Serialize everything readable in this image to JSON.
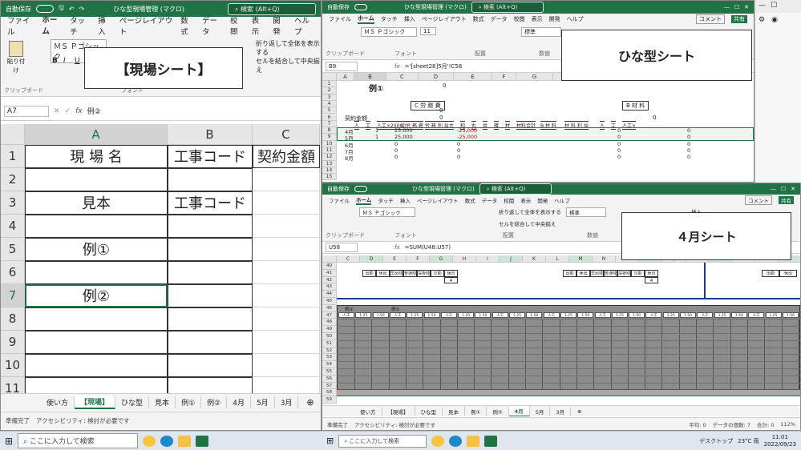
{
  "common": {
    "autosave": "自動保存",
    "autosave_state": "オフ",
    "filename": "ひな型現場管理 (マクロ)",
    "search": "検索 (Alt+Q)",
    "menus": [
      "ファイル",
      "ホーム",
      "タッチ",
      "挿入",
      "ページレイアウト",
      "数式",
      "データ",
      "校閲",
      "表示",
      "開発",
      "ヘルプ"
    ],
    "font": "ＭＳ Ｐゴシック",
    "font_size": "11",
    "wrap_btn": "折り返して全体を表示する",
    "merge_btn": "セルを結合して中央揃え",
    "number_format": "標準",
    "groups": {
      "clipboard": "クリップボード",
      "font": "フォント",
      "align": "配置",
      "number": "数値"
    },
    "paste": "貼り付け",
    "comment_btn": "コメント",
    "share_btn": "共有",
    "tabs": [
      "使い方",
      "【現場】",
      "ひな型",
      "見本",
      "例①",
      "例②",
      "4月",
      "5月",
      "3月"
    ],
    "status_ready": "準備完了",
    "status_access": "アクセシビリティ: 検討が必要です",
    "taskbar_search": "ここに入力して検索",
    "insert_btn": "挿入",
    "desktop": "デスクトップ",
    "weather": "23°C 雨",
    "clock_time": "11:01",
    "clock_date": "2022/09/23",
    "zoom": "112%"
  },
  "left": {
    "callout": "【現場シート】",
    "namebox": "A7",
    "formula": "例②",
    "columns": [
      "A",
      "B",
      "C"
    ],
    "rows": [
      {
        "n": "1",
        "a": "現 場 名",
        "b": "工事コード",
        "c": "契約金額"
      },
      {
        "n": "2",
        "a": "",
        "b": "",
        "c": ""
      },
      {
        "n": "3",
        "a": "見本",
        "b": "工事コード",
        "c": ""
      },
      {
        "n": "4",
        "a": "",
        "b": "",
        "c": ""
      },
      {
        "n": "5",
        "a": "例①",
        "b": "",
        "c": ""
      },
      {
        "n": "6",
        "a": "",
        "b": "",
        "c": ""
      },
      {
        "n": "7",
        "a": "例②",
        "b": "",
        "c": ""
      },
      {
        "n": "8",
        "a": "",
        "b": "",
        "c": ""
      },
      {
        "n": "9",
        "a": "",
        "b": "",
        "c": ""
      },
      {
        "n": "10",
        "a": "",
        "b": "",
        "c": ""
      },
      {
        "n": "11",
        "a": "",
        "b": "",
        "c": ""
      }
    ]
  },
  "top": {
    "callout": "ひな型シート",
    "namebox": "B9",
    "formula": "='[sheet28]5月'!C58",
    "columns": [
      "A",
      "B",
      "C",
      "D",
      "E",
      "F",
      "G",
      "H",
      "I"
    ],
    "title": "例①",
    "title_value": "0",
    "labor_label": "C 労 務 費",
    "contract_label": "契約金額",
    "contract_value": "0",
    "labor_value": "0",
    "material_label": "B 材 料",
    "material_value": "0",
    "headers": [
      "人",
      "工",
      "人工×25000",
      "C 労 務 費",
      "労 務 利 益",
      "大",
      "和",
      "丸",
      "井",
      "雑",
      "材",
      "材料合計",
      "B 材 料",
      "材 料 利 益",
      "",
      "人",
      "工",
      "人工×"
    ],
    "rows": [
      {
        "n": "8",
        "m": "4月",
        "v1": "1",
        "v2": "25,000",
        "v3": "-25,000",
        "v4": "0",
        "v5": "0"
      },
      {
        "n": "9",
        "m": "5月",
        "v1": "1",
        "v2": "25,000",
        "v3": "-25,000",
        "v4": "0",
        "v5": "0"
      },
      {
        "n": "10",
        "m": "6月",
        "v1": "",
        "v2": "0",
        "v3": "0",
        "v4": "0",
        "v5": "0"
      },
      {
        "n": "11",
        "m": "7月",
        "v1": "",
        "v2": "0",
        "v3": "0",
        "v4": "0",
        "v5": "0"
      },
      {
        "n": "12",
        "m": "8月",
        "v1": "",
        "v2": "0",
        "v3": "0",
        "v4": "0",
        "v5": "0"
      }
    ]
  },
  "bottom": {
    "callout": "４月シート",
    "namebox": "U58",
    "formula": "=SUM(U48:U57)",
    "columns": [
      "C",
      "D",
      "E",
      "F",
      "G",
      "H",
      "I",
      "J",
      "K",
      "L",
      "M",
      "N",
      "O",
      "P",
      "Q",
      "R",
      "S",
      "T",
      "U",
      "V"
    ],
    "summary_headers": [
      "出勤",
      "休出",
      "早出残",
      "普通残",
      "深夜残",
      "欠勤",
      "休日"
    ],
    "summary_value": "4",
    "section_labels": [
      "例①",
      "例②"
    ],
    "unit_labels": [
      "人工",
      "1.25",
      "1.50"
    ],
    "row_numbers": [
      "40",
      "41",
      "42",
      "43",
      "44",
      "45",
      "46",
      "47",
      "48",
      "49",
      "50",
      "51",
      "52",
      "53",
      "54",
      "55",
      "56",
      "57",
      "58",
      "59"
    ],
    "status_avg": "平均: 0",
    "status_count": "データの個数: 7",
    "status_sum": "合計: 0"
  }
}
